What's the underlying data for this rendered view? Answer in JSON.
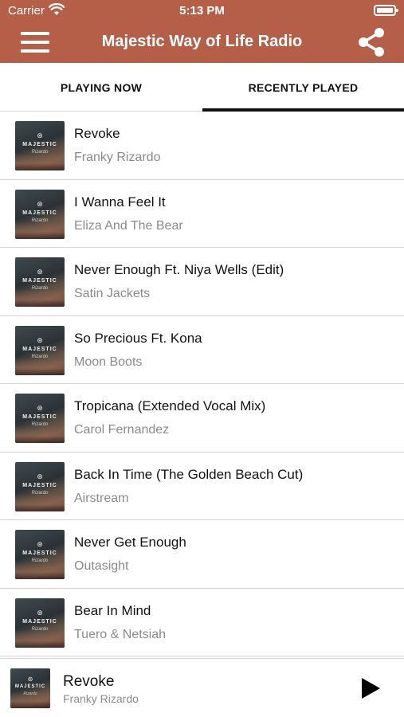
{
  "status_bar": {
    "carrier": "Carrier",
    "time": "5:13 PM"
  },
  "header": {
    "title": "Majestic Way of Life Radio",
    "menu_icon": "hamburger-menu-icon",
    "share_icon": "share-icon"
  },
  "tabs": [
    {
      "label": "PLAYING NOW",
      "active": false
    },
    {
      "label": "RECENTLY PLAYED",
      "active": true
    }
  ],
  "artwork": {
    "brand": "MAJESTIC",
    "sub": "Rizardo"
  },
  "tracks": [
    {
      "title": "Revoke",
      "artist": "Franky Rizardo"
    },
    {
      "title": "I Wanna Feel It",
      "artist": "Eliza And The Bear"
    },
    {
      "title": "Never Enough Ft. Niya Wells (Edit)",
      "artist": "Satin Jackets"
    },
    {
      "title": "So Precious Ft. Kona",
      "artist": "Moon Boots"
    },
    {
      "title": "Tropicana (Extended Vocal Mix)",
      "artist": "Carol Fernandez"
    },
    {
      "title": "Back In Time (The Golden Beach Cut)",
      "artist": "Airstream"
    },
    {
      "title": "Never Get Enough",
      "artist": "Outasight"
    },
    {
      "title": "Bear In Mind",
      "artist": "Tuero & Netsiah"
    }
  ],
  "now_playing": {
    "title": "Revoke",
    "artist": "Franky Rizardo",
    "control_icon": "play-icon"
  },
  "colors": {
    "header_bg": "#b55f48",
    "tab_indicator": "#111111",
    "secondary_text": "#8a8a8a"
  }
}
